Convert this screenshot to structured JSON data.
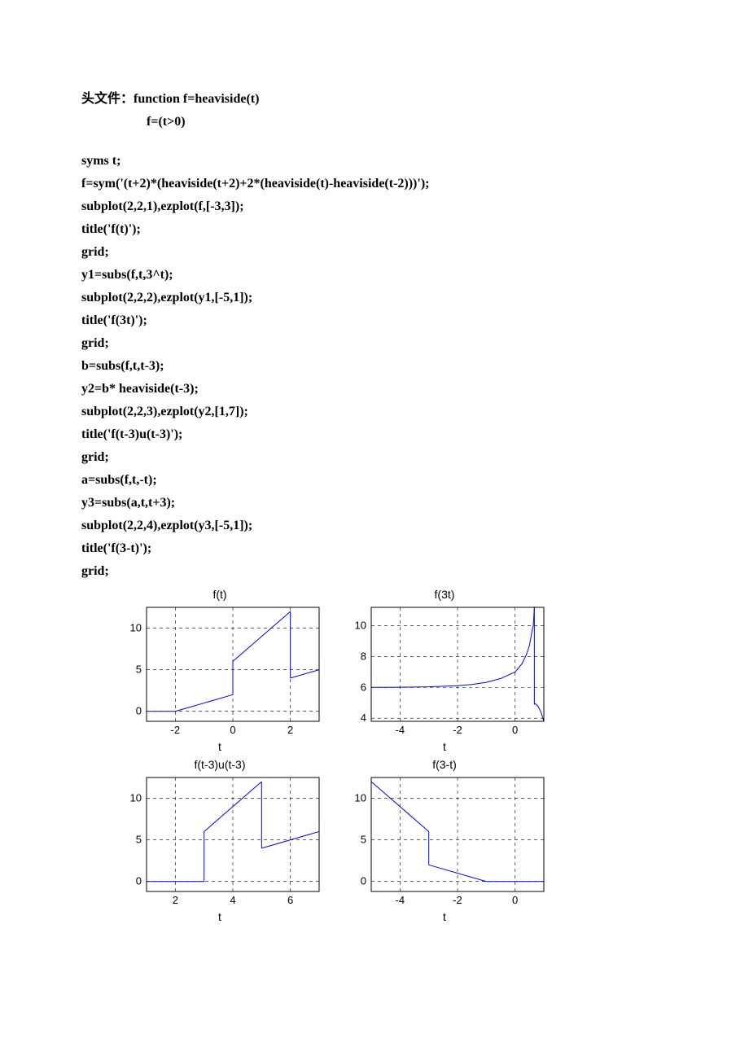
{
  "header": {
    "line1_prefix": "头文件：",
    "line1_code": "function f=heaviside(t)",
    "line2": "f=(t>0)"
  },
  "code": [
    "syms t;",
    "f=sym('(t+2)*(heaviside(t+2)+2*(heaviside(t)-heaviside(t-2)))');",
    "subplot(2,2,1),ezplot(f,[-3,3]);",
    "title('f(t)');",
    "grid;",
    "y1=subs(f,t,3^t);",
    "subplot(2,2,2),ezplot(y1,[-5,1]);",
    "title('f(3t)');",
    "grid;",
    "b=subs(f,t,t-3);",
    "y2=b* heaviside(t-3);",
    "subplot(2,2,3),ezplot(y2,[1,7]);",
    "title('f(t-3)u(t-3)');",
    "grid;",
    "a=subs(f,t,-t);",
    "y3=subs(a,t,t+3);",
    "subplot(2,2,4),ezplot(y3,[-5,1]);",
    "title('f(3-t)');",
    "grid;"
  ],
  "chart_data": [
    {
      "type": "line",
      "title": "f(t)",
      "xlabel": "t",
      "xlim": [
        -3,
        3
      ],
      "ylim": [
        -1.2,
        12.5
      ],
      "xticks": [
        -2,
        0,
        2
      ],
      "yticks": [
        0,
        5,
        10
      ],
      "segments": [
        {
          "points": [
            [
              -3,
              0
            ],
            [
              -2,
              0
            ]
          ]
        },
        {
          "points": [
            [
              -2,
              0
            ],
            [
              0,
              2
            ]
          ]
        },
        {
          "points": [
            [
              0,
              2
            ],
            [
              0,
              6
            ]
          ]
        },
        {
          "points": [
            [
              0,
              6
            ],
            [
              2,
              12
            ]
          ]
        },
        {
          "points": [
            [
              2,
              12
            ],
            [
              2,
              4
            ]
          ]
        },
        {
          "points": [
            [
              2,
              4
            ],
            [
              3,
              5
            ]
          ]
        }
      ]
    },
    {
      "type": "line",
      "title": "f(3t)",
      "xlabel": "t",
      "xlim": [
        -5,
        1
      ],
      "ylim": [
        3.8,
        11.2
      ],
      "xticks": [
        -4,
        -2,
        0
      ],
      "yticks": [
        4,
        6,
        8,
        10
      ],
      "segments": [
        {
          "points": [
            [
              -5,
              6.004
            ],
            [
              -4,
              6.012
            ],
            [
              -3,
              6.037
            ],
            [
              -2,
              6.111
            ],
            [
              -1.5,
              6.19
            ],
            [
              -1,
              6.33
            ],
            [
              -0.5,
              6.58
            ],
            [
              0,
              7
            ],
            [
              0.25,
              7.56
            ],
            [
              0.4,
              8.16
            ],
            [
              0.5,
              8.72
            ],
            [
              0.6,
              9.77
            ],
            [
              0.631,
              10.0
            ],
            [
              0.65,
              10.5
            ],
            [
              0.67,
              11.2
            ]
          ]
        },
        {
          "points": [
            [
              0.67,
              11.2
            ],
            [
              0.67,
              4.9
            ]
          ]
        },
        {
          "points": [
            [
              0.67,
              4.9
            ],
            [
              0.7,
              4.95
            ],
            [
              0.8,
              4.78
            ],
            [
              0.9,
              4.4
            ],
            [
              0.95,
              4.1
            ],
            [
              1.0,
              3.8
            ]
          ]
        }
      ]
    },
    {
      "type": "line",
      "title": "f(t-3)u(t-3)",
      "xlabel": "t",
      "xlim": [
        1,
        7
      ],
      "ylim": [
        -1.2,
        12.5
      ],
      "xticks": [
        2,
        4,
        6
      ],
      "yticks": [
        0,
        5,
        10
      ],
      "segments": [
        {
          "points": [
            [
              1,
              0
            ],
            [
              3,
              0
            ]
          ]
        },
        {
          "points": [
            [
              3,
              0
            ],
            [
              3,
              6
            ]
          ]
        },
        {
          "points": [
            [
              3,
              6
            ],
            [
              5,
              12
            ]
          ]
        },
        {
          "points": [
            [
              5,
              12
            ],
            [
              5,
              4
            ]
          ]
        },
        {
          "points": [
            [
              5,
              4
            ],
            [
              7,
              6
            ]
          ]
        }
      ]
    },
    {
      "type": "line",
      "title": "f(3-t)",
      "xlabel": "t",
      "xlim": [
        -5,
        1
      ],
      "ylim": [
        -1.2,
        12.5
      ],
      "xticks": [
        -4,
        -2,
        0
      ],
      "yticks": [
        0,
        5,
        10
      ],
      "segments": [
        {
          "points": [
            [
              -5,
              12
            ],
            [
              -3,
              6
            ]
          ]
        },
        {
          "points": [
            [
              -3,
              6
            ],
            [
              -3,
              2
            ]
          ]
        },
        {
          "points": [
            [
              -3,
              2
            ],
            [
              -1,
              0
            ]
          ]
        },
        {
          "points": [
            [
              -1,
              0
            ],
            [
              1,
              0
            ]
          ]
        }
      ]
    }
  ]
}
